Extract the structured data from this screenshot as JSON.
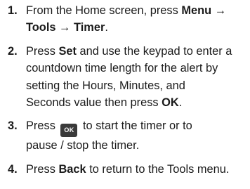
{
  "steps": [
    {
      "num": "1.",
      "line1_pre": "From the Home screen, press ",
      "line1_bold": "Menu →",
      "line2_bold": "Tools → Timer",
      "line2_post": "."
    },
    {
      "num": "2.",
      "line1_pre": "Press ",
      "line1_bold": "Set",
      "line1_post": " and use the keypad to enter a",
      "line2": "countdown time length for the alert by",
      "line3": "setting the Hours, Minutes, and",
      "line4_pre": "Seconds value then press ",
      "line4_bold": "OK",
      "line4_post": "."
    },
    {
      "num": "3.",
      "line1_pre": "Press ",
      "ok_key_label": "OK",
      "line1_post": " to start the timer or to",
      "line2": "pause / stop the timer."
    },
    {
      "num": "4.",
      "line1_pre": "Press ",
      "line1_bold": "Back",
      "line1_post": " to return to the Tools menu."
    }
  ]
}
